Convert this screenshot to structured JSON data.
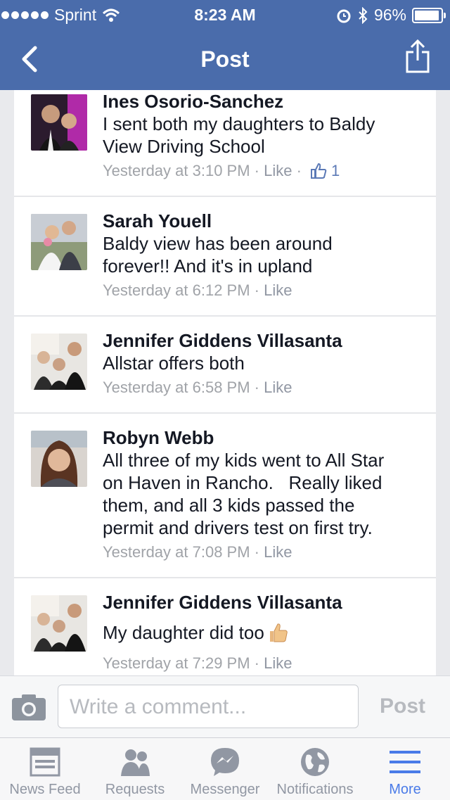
{
  "status_bar": {
    "carrier": "Sprint",
    "time": "8:23 AM",
    "battery": "96%"
  },
  "header": {
    "title": "Post"
  },
  "comments": [
    {
      "name": "Ines Osorio-Sanchez",
      "text": "I sent both my daughters to Baldy\nView Driving School",
      "time": "Yesterday at 3:10 PM",
      "like": "Like",
      "like_count": "1"
    },
    {
      "name": "Sarah Youell",
      "text": "Baldy view has been around\nforever!! And it's in upland",
      "time": "Yesterday at 6:12 PM",
      "like": "Like"
    },
    {
      "name": "Jennifer Giddens Villasanta",
      "text": "Allstar offers both",
      "time": "Yesterday at 6:58 PM",
      "like": "Like"
    },
    {
      "name": "Robyn Webb",
      "text": "All three of my kids went to All Star\non Haven in Rancho.   Really liked\nthem, and all 3 kids passed the\npermit and drivers test on first try.",
      "time": "Yesterday at 7:08 PM",
      "like": "Like"
    },
    {
      "name": "Jennifer Giddens Villasanta",
      "text": "My daughter did too",
      "time": "Yesterday at 7:29 PM",
      "like": "Like"
    }
  ],
  "composer": {
    "placeholder": "Write a comment...",
    "post_label": "Post"
  },
  "tabs": [
    {
      "label": "News Feed",
      "icon": "news-feed-icon"
    },
    {
      "label": "Requests",
      "icon": "requests-icon"
    },
    {
      "label": "Messenger",
      "icon": "messenger-icon"
    },
    {
      "label": "Notifications",
      "icon": "notifications-icon"
    },
    {
      "label": "More",
      "icon": "more-icon",
      "active": true
    }
  ],
  "colors": {
    "header": "#4a6cab",
    "active_tab": "#4a7be8",
    "meta": "#a0a3a8"
  }
}
